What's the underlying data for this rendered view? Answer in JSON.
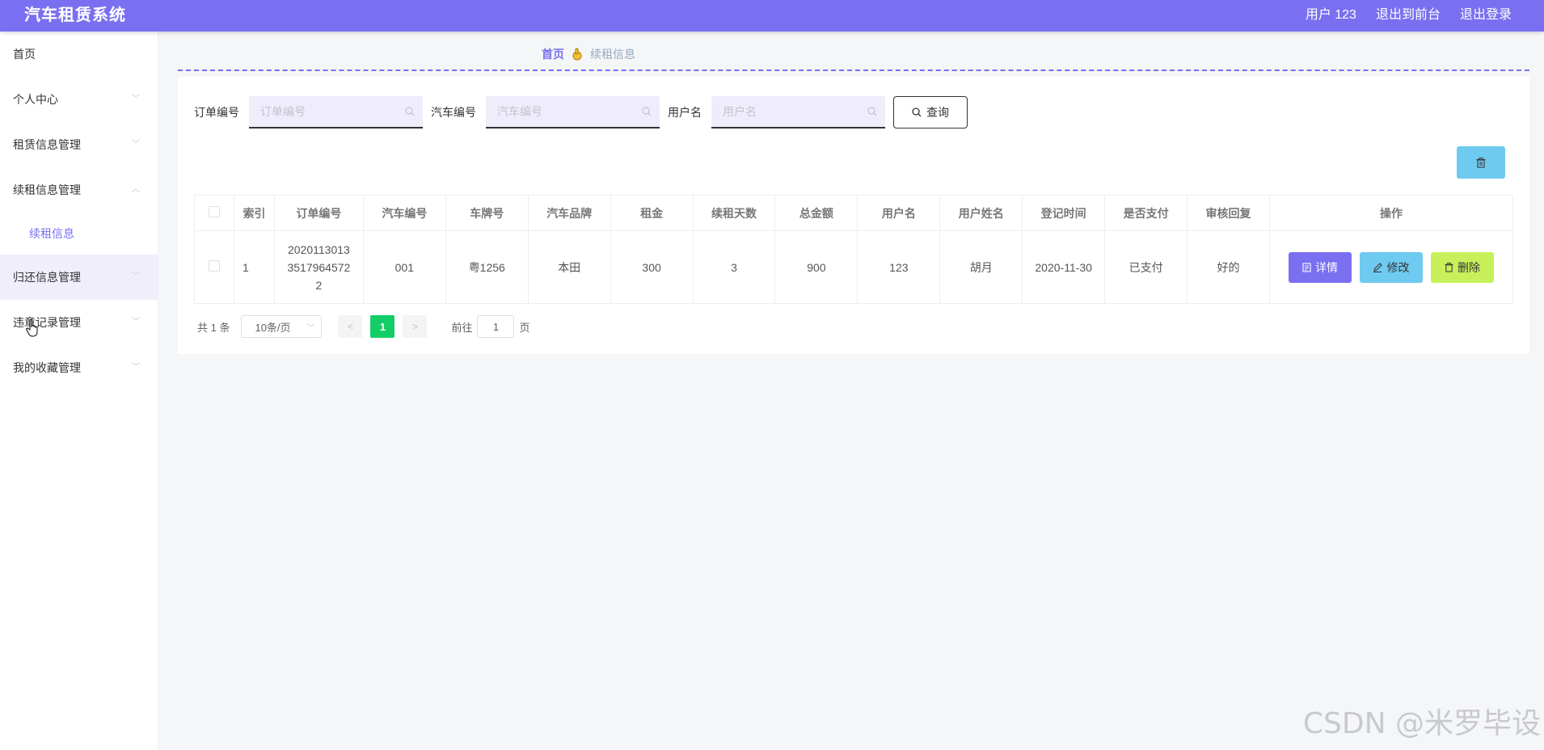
{
  "header": {
    "title": "汽车租赁系统",
    "user": "用户 123",
    "to_front": "退出到前台",
    "logout": "退出登录"
  },
  "sidebar": {
    "items": [
      {
        "label": "首页"
      },
      {
        "label": "个人中心"
      },
      {
        "label": "租赁信息管理"
      },
      {
        "label": "续租信息管理"
      },
      {
        "label": "续租信息"
      },
      {
        "label": "归还信息管理"
      },
      {
        "label": "违章记录管理"
      },
      {
        "label": "我的收藏管理"
      }
    ]
  },
  "breadcrumb": {
    "home": "首页",
    "current": "续租信息"
  },
  "search": {
    "order_label": "订单编号",
    "order_placeholder": "订单编号",
    "car_label": "汽车编号",
    "car_placeholder": "汽车编号",
    "user_label": "用户名",
    "user_placeholder": "用户名",
    "query_label": "查询"
  },
  "table": {
    "headers": [
      "索引",
      "订单编号",
      "汽车编号",
      "车牌号",
      "汽车品牌",
      "租金",
      "续租天数",
      "总金额",
      "用户名",
      "用户姓名",
      "登记时间",
      "是否支付",
      "审核回复",
      "操作"
    ],
    "rows": [
      {
        "index": "1",
        "order_l1": "2020113013",
        "order_l2": "3517964572",
        "order_l3": "2",
        "car_no": "001",
        "plate": "粤1256",
        "brand": "本田",
        "rent": "300",
        "days": "3",
        "total": "900",
        "username": "123",
        "name": "胡月",
        "date": "2020-11-30",
        "paid": "已支付",
        "reply": "好的",
        "detail": "详情",
        "edit": "修改",
        "delete": "删除"
      }
    ]
  },
  "pagination": {
    "total": "共 1 条",
    "page_size": "10条/页",
    "current": "1",
    "goto_prefix": "前往",
    "goto_value": "1",
    "goto_suffix": "页"
  },
  "watermark": "CSDN @米罗毕设",
  "colors": {
    "primary": "#7a6ff0",
    "info": "#6fcaf0",
    "danger_alt": "#c8f05a",
    "success": "#13ce66"
  }
}
